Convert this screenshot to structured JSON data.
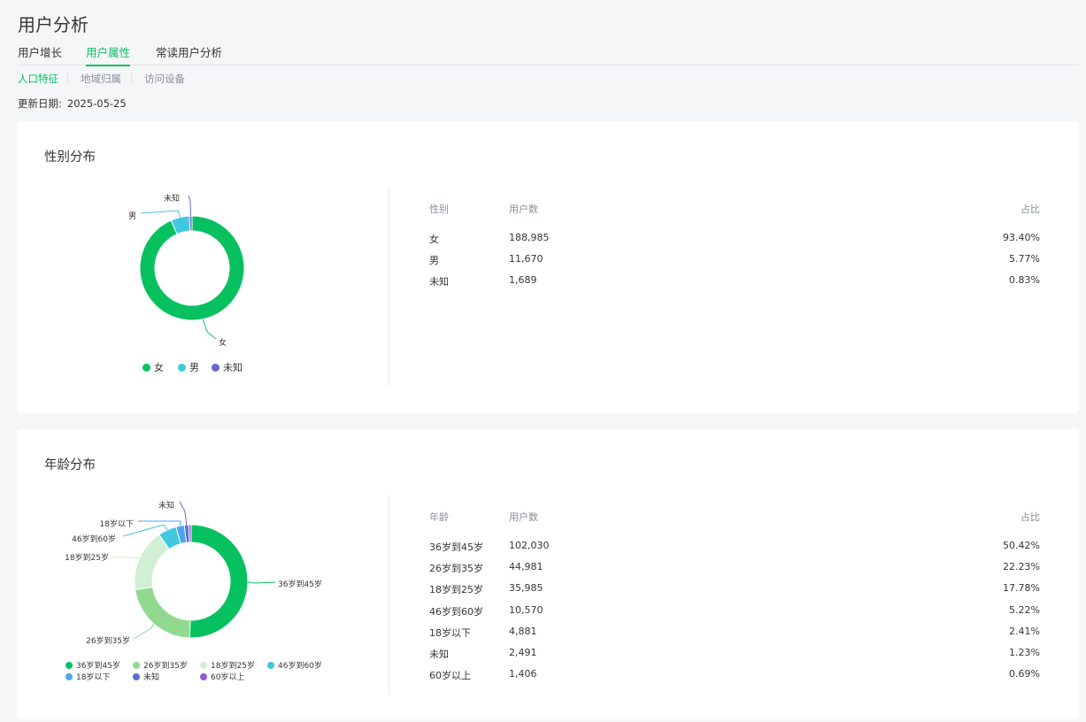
{
  "page": {
    "title": "用户分析"
  },
  "tabs": [
    {
      "label": "用户增长",
      "active": false
    },
    {
      "label": "用户属性",
      "active": true
    },
    {
      "label": "常读用户分析",
      "active": false
    }
  ],
  "sub_tabs": [
    {
      "label": "人口特征",
      "active": true
    },
    {
      "label": "地域归属",
      "active": false
    },
    {
      "label": "访问设备",
      "active": false
    }
  ],
  "update": {
    "label": "更新日期:",
    "date": "2025-05-25"
  },
  "gender": {
    "title": "性别分布",
    "columns": [
      "性别",
      "用户数",
      "占比"
    ],
    "rows": [
      {
        "name": "女",
        "count": "188,985",
        "percent": "93.40%"
      },
      {
        "name": "男",
        "count": "11,670",
        "percent": "5.77%"
      },
      {
        "name": "未知",
        "count": "1,689",
        "percent": "0.83%"
      }
    ],
    "colors": [
      "#07c160",
      "#3fc8e0",
      "#6468d1"
    ],
    "chart_data": {
      "type": "pie",
      "donut": true,
      "categories": [
        "女",
        "男",
        "未知"
      ],
      "values": [
        188985,
        11670,
        1689
      ],
      "legend": "bottom"
    }
  },
  "age": {
    "title": "年龄分布",
    "columns": [
      "年龄",
      "用户数",
      "占比"
    ],
    "rows": [
      {
        "name": "36岁到45岁",
        "count": "102,030",
        "percent": "50.42%"
      },
      {
        "name": "26岁到35岁",
        "count": "44,981",
        "percent": "22.23%"
      },
      {
        "name": "18岁到25岁",
        "count": "35,985",
        "percent": "17.78%"
      },
      {
        "name": "46岁到60岁",
        "count": "10,570",
        "percent": "5.22%"
      },
      {
        "name": "18岁以下",
        "count": "4,881",
        "percent": "2.41%"
      },
      {
        "name": "未知",
        "count": "2,491",
        "percent": "1.23%"
      },
      {
        "name": "60岁以上",
        "count": "1,406",
        "percent": "0.69%"
      }
    ],
    "colors": [
      "#07c160",
      "#91d98e",
      "#d1efd2",
      "#3fc8e0",
      "#4aa6ef",
      "#5b6cd6",
      "#8c5ad3"
    ],
    "chart_data": {
      "type": "pie",
      "donut": true,
      "categories": [
        "36岁到45岁",
        "26岁到35岁",
        "18岁到25岁",
        "46岁到60岁",
        "18岁以下",
        "未知",
        "60岁以上"
      ],
      "values": [
        102030,
        44981,
        35985,
        10570,
        4881,
        2491,
        1406
      ],
      "legend": "bottom"
    }
  }
}
